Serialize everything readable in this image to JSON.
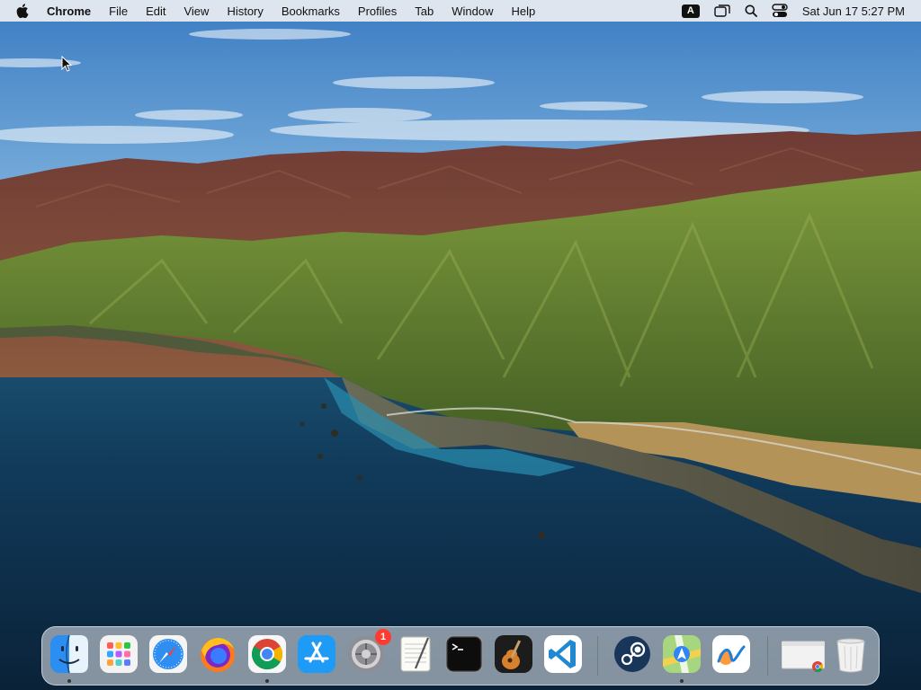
{
  "menubar": {
    "app_name": "Chrome",
    "menus": [
      "File",
      "Edit",
      "View",
      "History",
      "Bookmarks",
      "Profiles",
      "Tab",
      "Window",
      "Help"
    ],
    "input_source": "A",
    "clock": "Sat Jun 17  5:27 PM"
  },
  "dock": {
    "apps": [
      {
        "name": "Finder",
        "icon": "finder-icon",
        "running": true
      },
      {
        "name": "Launchpad",
        "icon": "launchpad-icon",
        "running": false
      },
      {
        "name": "Safari",
        "icon": "safari-icon",
        "running": false
      },
      {
        "name": "Firefox",
        "icon": "firefox-icon",
        "running": false
      },
      {
        "name": "Google Chrome",
        "icon": "chrome-icon",
        "running": true
      },
      {
        "name": "App Store",
        "icon": "app-store-icon",
        "running": false
      },
      {
        "name": "System Preferences",
        "icon": "settings-icon",
        "running": false,
        "badge": "1"
      },
      {
        "name": "TextEdit",
        "icon": "textedit-icon",
        "running": false
      },
      {
        "name": "Terminal",
        "icon": "terminal-icon",
        "running": false
      },
      {
        "name": "GarageBand",
        "icon": "garageband-icon",
        "running": false
      },
      {
        "name": "Visual Studio Code",
        "icon": "vscode-icon",
        "running": false
      },
      {
        "name": "Steam",
        "icon": "steam-icon",
        "running": false
      },
      {
        "name": "Maps",
        "icon": "maps-icon",
        "running": true
      },
      {
        "name": "Freeform",
        "icon": "freeform-icon",
        "running": false
      },
      {
        "name": "Chrome Window",
        "icon": "chrome-window-thumbnail-icon",
        "running": false
      },
      {
        "name": "Trash",
        "icon": "trash-icon",
        "running": false
      }
    ]
  },
  "colors": {
    "sky_top": "#3f7fc4",
    "sky_horizon": "#bcd8ee",
    "ocean": "#0f3350",
    "mountain_red": "#8a4a3a",
    "mountain_green": "#5d7a2e",
    "badge": "#ff3b30"
  }
}
